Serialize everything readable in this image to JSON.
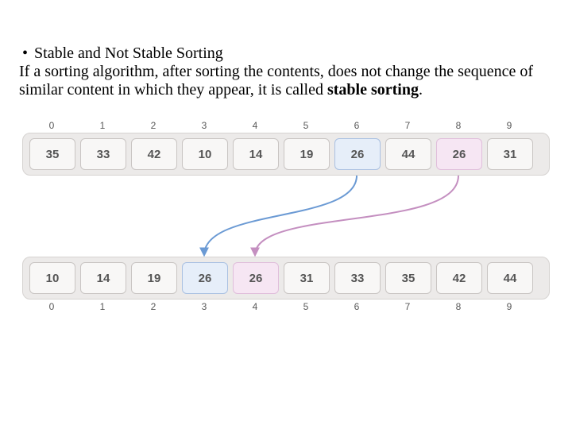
{
  "heading": "Stable and Not Stable Sorting",
  "body": "If a sorting algorithm, after sorting the contents, does not change the sequence of similar content in which they appear, it is called ",
  "body_bold": "stable sorting",
  "body_tail": ".",
  "chart_data": {
    "type": "table",
    "indices": [
      "0",
      "1",
      "2",
      "3",
      "4",
      "5",
      "6",
      "7",
      "8",
      "9"
    ],
    "unsorted": {
      "values": [
        "35",
        "33",
        "42",
        "10",
        "14",
        "19",
        "26",
        "44",
        "26",
        "31"
      ],
      "highlights": [
        {
          "index": 6,
          "class": "blue"
        },
        {
          "index": 8,
          "class": "pink"
        }
      ]
    },
    "sorted": {
      "values": [
        "10",
        "14",
        "19",
        "26",
        "26",
        "31",
        "33",
        "35",
        "42",
        "44"
      ],
      "highlights": [
        {
          "index": 3,
          "class": "blue"
        },
        {
          "index": 4,
          "class": "pink"
        }
      ]
    },
    "mappings": [
      {
        "from": 6,
        "to": 3,
        "color": "#6b9ad4"
      },
      {
        "from": 8,
        "to": 4,
        "color": "#c48fc0"
      }
    ]
  }
}
